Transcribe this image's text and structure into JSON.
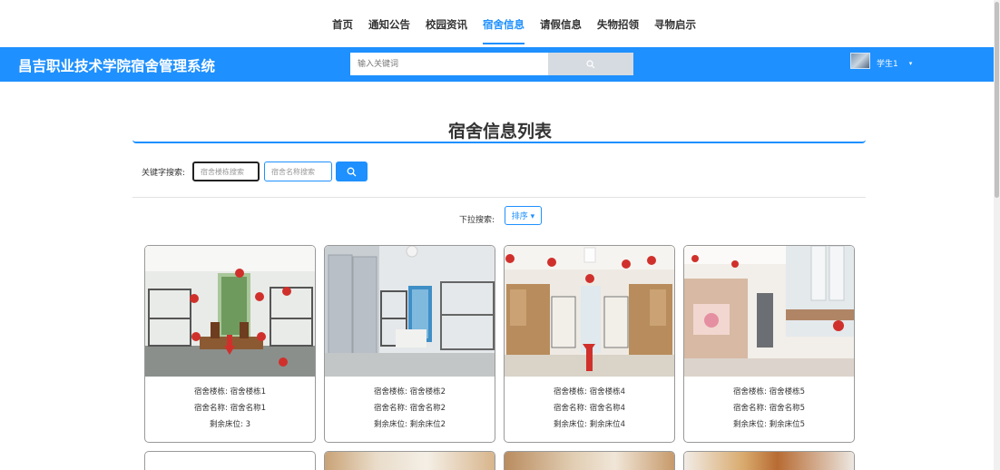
{
  "nav": {
    "items": [
      {
        "label": "首页"
      },
      {
        "label": "通知公告"
      },
      {
        "label": "校园资讯"
      },
      {
        "label": "宿舍信息",
        "active": true
      },
      {
        "label": "请假信息"
      },
      {
        "label": "失物招领"
      },
      {
        "label": "寻物启示"
      }
    ]
  },
  "header": {
    "site_title": "昌吉职业技术学院宿舍管理系统",
    "search_placeholder": "输入关键词",
    "search_icon": "search-icon",
    "username": "学生1",
    "user_caret": "▾"
  },
  "page": {
    "title": "宿舍信息列表",
    "keyword_label": "关键字搜索:",
    "building_placeholder": "宿舍楼栋搜索",
    "name_placeholder": "宿舍名称搜索",
    "dropdown_label": "下拉搜索:",
    "sort_label": "排序 ▾"
  },
  "cards": [
    {
      "building": "宿舍楼栋: 宿舍楼栋1",
      "name": "宿舍名称: 宿舍名称1",
      "beds": "剩余床位: 3"
    },
    {
      "building": "宿舍楼栋: 宿舍楼栋2",
      "name": "宿舍名称: 宿舍名称2",
      "beds": "剩余床位: 剩余床位2"
    },
    {
      "building": "宿舍楼栋: 宿舍楼栋4",
      "name": "宿舍名称: 宿舍名称4",
      "beds": "剩余床位: 剩余床位4"
    },
    {
      "building": "宿舍楼栋: 宿舍楼栋5",
      "name": "宿舍名称: 宿舍名称5",
      "beds": "剩余床位: 剩余床位5"
    }
  ],
  "colors": {
    "primary": "#1e90ff",
    "search_button": "#d6dbe1"
  }
}
